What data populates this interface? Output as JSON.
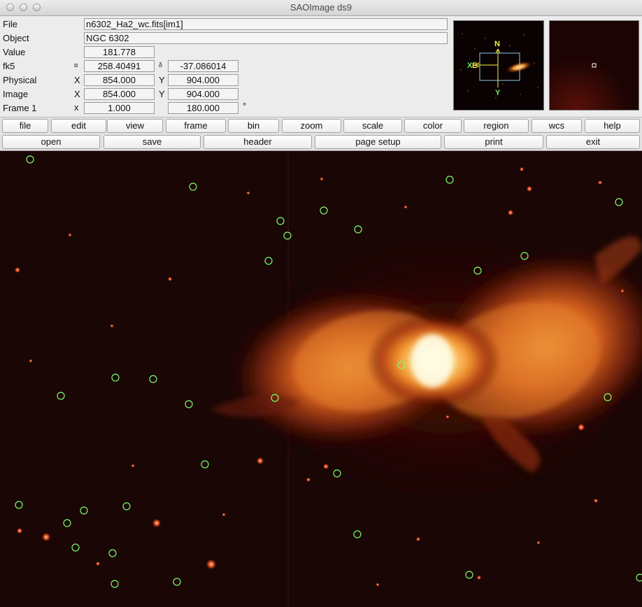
{
  "window": {
    "title": "SAOImage ds9"
  },
  "info": {
    "file_label": "File",
    "file_value": "n6302_Ha2_wc.fits[im1]",
    "object_label": "Object",
    "object_value": "NGC 6302",
    "value_label": "Value",
    "value_value": "181.778",
    "fk5_label": "fk5",
    "alpha_symbol": "α",
    "fk5_alpha": "258.40491",
    "delta_symbol": "δ",
    "fk5_delta": "-37.086014",
    "physical_label": "Physical",
    "physical_x_symbol": "X",
    "physical_x": "854.000",
    "physical_y_symbol": "Y",
    "physical_y": "904.000",
    "image_label": "Image",
    "image_x_symbol": "X",
    "image_x": "854.000",
    "image_y_symbol": "Y",
    "image_y": "904.000",
    "frame_label": "Frame 1",
    "frame_zoom_symbol": "x",
    "frame_zoom": "1.000",
    "frame_angle": "180.000",
    "degree_symbol": "°"
  },
  "panner": {
    "north_label": "N",
    "east_label": "E",
    "x_label": "X",
    "y_label": "Y"
  },
  "menubar": [
    "file",
    "edit",
    "view",
    "frame",
    "bin",
    "zoom",
    "scale",
    "color",
    "region",
    "wcs",
    "help"
  ],
  "buttonbar": [
    "open",
    "save",
    "header",
    "page setup",
    "print",
    "exit"
  ],
  "colors": {
    "region_circle": "#7CFC6B",
    "background": "#1a0605",
    "compass_yellow": "#f5f542",
    "compass_green": "#6cf06c",
    "panner_box": "#8fc7e8"
  },
  "canvas": {
    "icons": [
      "nebula-image",
      "region-circle"
    ],
    "region_count": 33
  }
}
